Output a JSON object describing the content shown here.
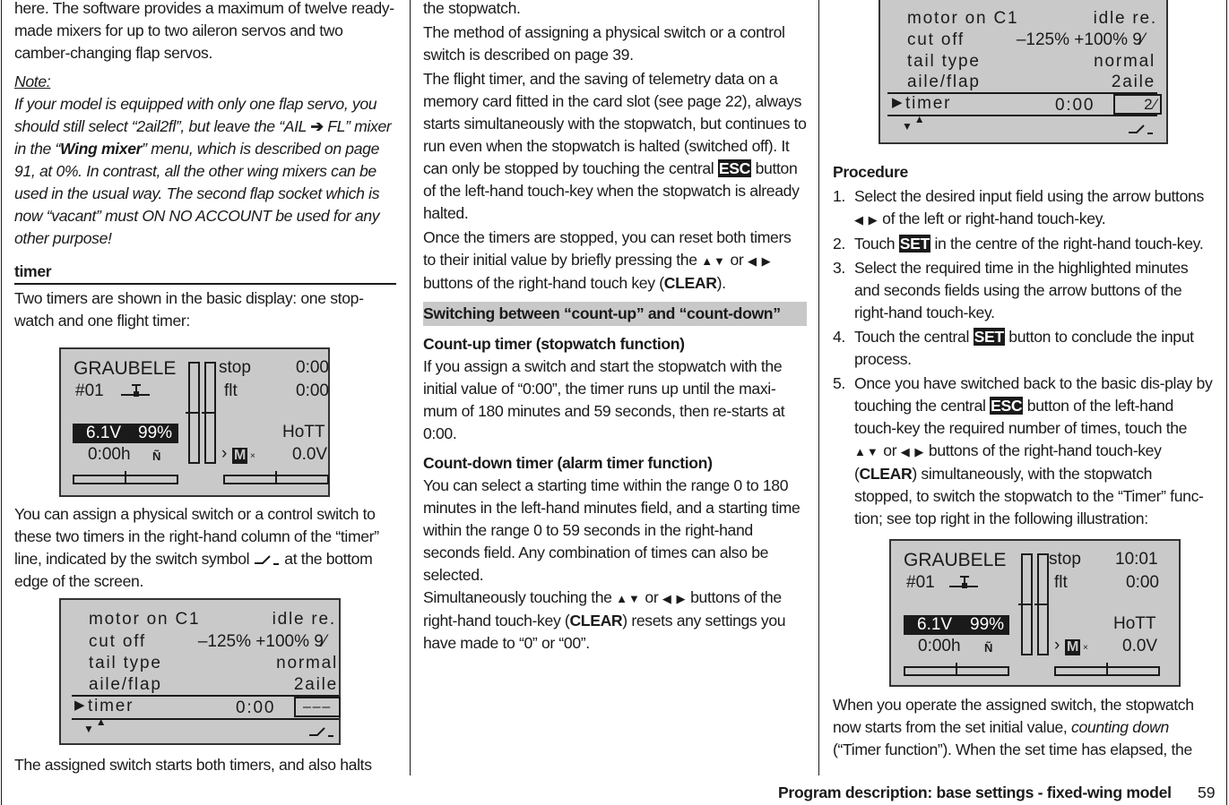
{
  "col1": {
    "p_intro": "here. The software provides a maximum of twelve ready-made mixers for up to two aileron servos and two camber-changing flap servos.",
    "note_label": "Note:",
    "note_a": "If your model is equipped with only one flap servo, you should still select “2ail2fl”, but leave the “AIL ",
    "note_arrow": "➔",
    "note_b": " FL” mixer in the “",
    "note_bold": "Wing mixer",
    "note_c": "” menu, which is described on page 91, at 0%. In contrast, all the other wing mixers can be used in the usual way. The second flap socket which is now “vacant” must ON NO ACCOUNT be used for any other purpose!",
    "timer_heading": "timer",
    "p_two_timers": "Two timers are shown in the basic display: one stop-watch and one flight timer:",
    "p_assign_a": "You can assign a physical switch or a control switch to these two timers in the right-hand column of the “timer” line, indicated by the switch symbol ",
    "p_assign_b": " at the bottom edge of the screen.",
    "p_halts": "The assigned switch starts both timers, and also halts"
  },
  "col2": {
    "p_stopwatch": "the stopwatch.",
    "p_method": "The method of assigning a physical switch or a control switch is described on page 39.",
    "p_flight_a": "The flight timer, and the saving of telemetry data on a memory card fitted in the card slot (see page 22), always starts simultaneously with the stopwatch, but continues to run even when the stopwatch is halted (switched off). It can only be stopped by touching the central ",
    "esc": "ESC",
    "p_flight_b": " button of the left-hand touch-key when the stopwatch is already halted.",
    "p_reset_a": "Once the timers are stopped, you can reset both timers to their initial value by briefly pressing the ",
    "arrows_ud": "▲▼",
    "or": " or ",
    "arrows_lr": "◀ ▶",
    "p_reset_b": " buttons of the right-hand touch key (",
    "clear": "CLEAR",
    "p_reset_c": ").",
    "switch_heading": "Switching between “count-up” and “count-down”",
    "countup_heading": "Count-up timer (stopwatch function)",
    "p_countup": "If you assign a switch and start the stopwatch with the initial value of “0:00”, the timer runs up until the maxi-mum of 180 minutes and 59 seconds, then re-starts at 0:00.",
    "countdown_heading": "Count-down timer (alarm timer function)",
    "p_countdown": "You can select a starting time within the range 0 to 180 minutes in the left-hand minutes field, and a starting time within the range 0 to 59 seconds in the right-hand seconds field. Any combination of times can also be selected.",
    "p_simul_a": "Simultaneously touching the ",
    "p_simul_b": " buttons of the right-hand touch-key (",
    "p_simul_c": ") resets any settings you have made to “0” or “00”."
  },
  "col3": {
    "procedure_heading": "Procedure",
    "steps": [
      {
        "num": "1.",
        "a": "Select the desired input field using the arrow buttons ",
        "b": " of the left or right-hand touch-key."
      },
      {
        "num": "2.",
        "a": "Touch ",
        "key": "SET",
        "b": " in the centre of the right-hand touch-key."
      },
      {
        "num": "3.",
        "a": "Select the required time in the highlighted minutes and seconds fields using the arrow buttons of the right-hand touch-key."
      },
      {
        "num": "4.",
        "a": "Touch the central ",
        "key": "SET",
        "b": " button to conclude the input process."
      },
      {
        "num": "5.",
        "a": "Once you have switched back to the basic dis-play by touching the central ",
        "key": "ESC",
        "b": " button of the left-hand touch-key the required number of times, touch the ",
        "c": " buttons of the right-hand touch-key (",
        "d": ") simultaneously, with the stopwatch stopped, to switch the stopwatch to the “Timer” func-tion; see top right in the following illustration:"
      }
    ],
    "p_operate_a": "When you operate the assigned switch, the stopwatch now starts from the set initial value, ",
    "p_operate_ital": "counting down",
    "p_operate_b": " (“Timer function”). When the set time has elapsed, the"
  },
  "lcd_main_1": {
    "model_name": "GRAUBELE",
    "model_num": "#01",
    "stop_label": "stop",
    "stop_time": "0:00",
    "flt_label": "flt",
    "flt_time": "0:00",
    "voltage": "6.1V",
    "battery_pct": "99%",
    "hours": "0:00h",
    "rf_label": "HoTT",
    "rx_voltage": "0.0V",
    "mode_letter": "M",
    "icons": [
      "plane-icon",
      "antenna-icon",
      "model-memory-icon"
    ]
  },
  "lcd_main_2": {
    "model_name": "GRAUBELE",
    "model_num": "#01",
    "stop_label": "stop",
    "stop_time": "10:01",
    "flt_label": "flt",
    "flt_time": "0:00",
    "voltage": "6.1V",
    "battery_pct": "99%",
    "hours": "0:00h",
    "rf_label": "HoTT",
    "rx_voltage": "0.0V",
    "mode_letter": "M"
  },
  "lcd_menu_1": {
    "rows": [
      {
        "label": "motor  on  C1",
        "value": "idle  re."
      },
      {
        "label": "cut  off",
        "value": "–125% +100%  9⁄"
      },
      {
        "label": "tail  type",
        "value": "normal"
      },
      {
        "label": "aile/flap",
        "value": "2aile"
      }
    ],
    "selected_label": "timer",
    "selected_time": "0:00",
    "switch_value": "–––"
  },
  "lcd_menu_2": {
    "rows": [
      {
        "label": "motor  on  C1",
        "value": "idle  re."
      },
      {
        "label": "cut  off",
        "value": "–125% +100%  9⁄"
      },
      {
        "label": "tail  type",
        "value": "normal"
      },
      {
        "label": "aile/flap",
        "value": "2aile"
      }
    ],
    "selected_label": "timer",
    "selected_time": "0:00",
    "switch_value": "2⁄"
  },
  "footer": {
    "title": "Program description: base settings - fixed-wing model",
    "page": "59"
  }
}
